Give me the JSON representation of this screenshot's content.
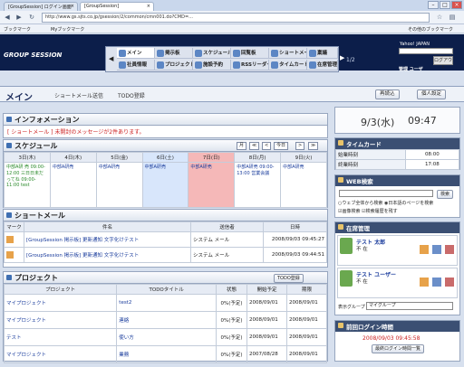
{
  "browser": {
    "tabs": [
      "[GroupSession] ログイン画面",
      "[GroupSession]"
    ],
    "url": "http://www.gs.sjts.co.jp/gsession/2/common/cmn001.do?CMD=..."
  },
  "bookmarks": [
    "ブックマーク",
    "Myブックマーク",
    "その他のブックマーク"
  ],
  "header": {
    "logo": "GROUP SESSION",
    "yahoo": "Yahoo! JAPAN",
    "logout": "ログアウト",
    "user": "管理 ユーザ",
    "page": "1/2",
    "menu": [
      "メイン",
      "掲示板",
      "スケジュール",
      "回覧板",
      "ショートメール",
      "稟議",
      "社員情報",
      "プロジェクト",
      "施設予約",
      "RSSリーダー",
      "タイムカード",
      "在席管理"
    ]
  },
  "toolbar": {
    "title": "メイン",
    "links": [
      "ショートメール送信",
      "TODO登録"
    ],
    "reload": "再読込",
    "settings": "個人設定"
  },
  "info": {
    "title": "インフォメーション",
    "message": "[ ショートメール ] 未開封のメッセージが2件あります。"
  },
  "schedule": {
    "title": "スケジュール",
    "nav": [
      "月",
      "≪",
      "<",
      "今日",
      ">",
      "≫"
    ],
    "days": [
      "3日(木)",
      "4日(木)",
      "5日(金)",
      "6日(土)",
      "7日(日)",
      "8日(月)",
      "9日(火)"
    ],
    "entries": [
      [
        "中部A研 売 09:00-12:00 三日日未だってね 09:00-11:00 test",
        "中部A研売",
        "中部A研売",
        "中部A研売",
        "中部A研売",
        "中部A研売 09:00-13:00 営業会議",
        "中部A研売"
      ],
      [
        "",
        "",
        "",
        "",
        "",
        "",
        ""
      ]
    ]
  },
  "shortmail": {
    "title": "ショートメール",
    "headers": [
      "マーク",
      "件名",
      "送信者",
      "日時"
    ],
    "rows": [
      {
        "subject": "[GroupSession 掲示板] 更新通知 文字化けテスト",
        "sender": "システム メール",
        "date": "2008/09/03 09:45:27"
      },
      {
        "subject": "[GroupSession 掲示板] 更新通知 文字化けテスト",
        "sender": "システム メール",
        "date": "2008/09/03 09:44:51"
      }
    ]
  },
  "project": {
    "title": "プロジェクト",
    "add": "TODO登録",
    "headers": [
      "プロジェクト",
      "TODOタイトル",
      "状態",
      "開始予定",
      "期限"
    ],
    "rows": [
      {
        "project": "マイプロジェクト",
        "todo": "test2",
        "status": "0%(予定)",
        "start": "2008/09/01",
        "limit": "2008/09/01"
      },
      {
        "project": "マイプロジェクト",
        "todo": "連絡",
        "status": "0%(予定)",
        "start": "2008/09/01",
        "limit": "2008/09/01"
      },
      {
        "project": "テスト",
        "todo": "使い方",
        "status": "0%(予定)",
        "start": "2008/09/01",
        "limit": "2008/09/01"
      },
      {
        "project": "マイプロジェクト",
        "todo": "業務",
        "status": "0%(予定)",
        "start": "2007/08/28",
        "limit": "2008/09/01"
      }
    ]
  },
  "clock": {
    "date": "9/3(水)",
    "time": "09:47"
  },
  "timecard": {
    "title": "タイムカード",
    "rows": [
      {
        "label": "始業時刻",
        "value": "08:00"
      },
      {
        "label": "終業時刻",
        "value": "17:08"
      }
    ]
  },
  "websearch": {
    "title": "WEB検索",
    "button": "検索",
    "options": [
      "ウェブ全体から検索",
      "日本語のページを検索",
      "画像検索",
      "検索履歴を残す"
    ]
  },
  "presence": {
    "title": "在席管理",
    "users": [
      {
        "name": "テスト 太郎",
        "state": "不 在"
      },
      {
        "name": "テスト ユーザー",
        "state": "不 在"
      }
    ],
    "group_label": "表示グループ",
    "group_value": "マイグループ"
  },
  "lastlogin": {
    "title": "前回ログイン時間",
    "time": "2008/09/03 09:45:58",
    "button": "最終ログイン時間一覧"
  },
  "colors": {
    "header": "#0c1e4a",
    "accent": "#3f6fb2",
    "today": "#f5b8b8",
    "saturday": "#d8e6fb"
  }
}
